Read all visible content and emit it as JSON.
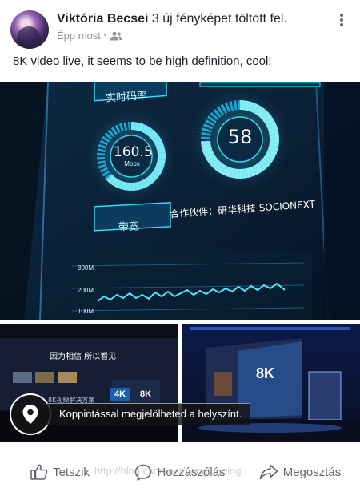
{
  "post": {
    "author_name": "Viktória Becsei",
    "action_text": " 3 új fényképet töltött fel.",
    "timestamp": "Épp most",
    "audience_icon": "friends-icon",
    "text": "8K video live, it seems to be high definition, cool!"
  },
  "photo_main": {
    "panel_top_label": "实时码率",
    "gauge_left_value": "160.5",
    "gauge_left_unit": "Mbps",
    "gauge_right_value": "58",
    "panel_bottom_label": "带宽",
    "partner_text": "合作伙伴：研华科技  SOCIONEXT",
    "y_labels": [
      "300M",
      "200M",
      "100M"
    ]
  },
  "photo_left": {
    "headline": "因为相信 所以看见",
    "badge_4k": "4K",
    "badge_8k": "8K",
    "caption": "8K视频解决方案"
  },
  "photo_right": {
    "stage_text": "8K"
  },
  "location": {
    "label": "Koppintással megjelölheted a helyszínt.",
    "icon": "map-pin-icon"
  },
  "actions": [
    {
      "label": "Tetszik",
      "icon": "thumbs-up-icon"
    },
    {
      "label": "Hozzászólás",
      "icon": "comment-icon"
    },
    {
      "label": "Megosztás",
      "icon": "share-icon"
    }
  ],
  "watermark": "http://blog.csdn.net/yangluoning"
}
